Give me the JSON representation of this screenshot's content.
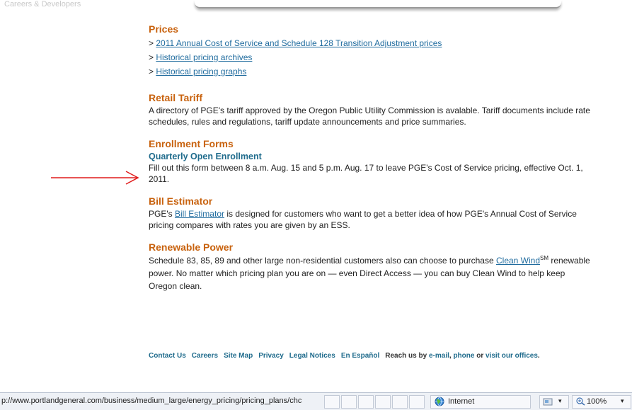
{
  "header": {
    "faded_text": "Careers & Developers"
  },
  "sections": {
    "prices": {
      "heading": "Prices",
      "links": [
        {
          "prefix": "> ",
          "label": "2011 Annual Cost of Service and Schedule 128 Transition Adjustment prices"
        },
        {
          "prefix": "> ",
          "label": "Historical pricing archives"
        },
        {
          "prefix": "> ",
          "label": "Historical pricing graphs"
        }
      ]
    },
    "retail_tariff": {
      "heading": "Retail Tariff",
      "body": "A directory of PGE's tariff approved by the Oregon Public Utility Commission is avalable. Tariff documents include rate schedules, rules and regulations, tariff update announcements and price summaries."
    },
    "enrollment_forms": {
      "heading": "Enrollment Forms",
      "subheading": "Quarterly Open Enrollment",
      "body": "Fill out this form between 8 a.m. Aug. 15 and 5 p.m. Aug. 17 to leave PGE's Cost of Service pricing, effective Oct. 1, 2011."
    },
    "bill_estimator": {
      "heading": "Bill Estimator",
      "body_before": "PGE's ",
      "link": "Bill Estimator",
      "body_after": " is designed for customers who want to get a better idea of how PGE's Annual Cost of Service pricing compares with rates you are given by an ESS."
    },
    "renewable_power": {
      "heading": "Renewable Power",
      "body_before": "Schedule 83, 85, 89 and other large non-residential customers also can choose to purchase ",
      "link": "Clean Wind",
      "sup": "SM",
      "body_after": " renewable power. No matter which pricing plan you are on — even Direct Access — you can buy Clean Wind to help keep Oregon clean."
    }
  },
  "footer": {
    "links": [
      "Contact Us",
      "Careers",
      "Site Map",
      "Privacy",
      "Legal Notices",
      "En Español"
    ],
    "reach_prefix": "Reach us by ",
    "email_link": "e-mail",
    "reach_sep1": ", ",
    "phone_link": "phone",
    "reach_sep2": " or ",
    "offices_link": "visit our offices",
    "reach_suffix": "."
  },
  "statusbar": {
    "url": "p://www.portlandgeneral.com/business/medium_large/energy_pricing/pricing_plans/chc",
    "zone": "Internet",
    "zoom": "100%",
    "zoom_caret": "▾",
    "protect_caret": "▾"
  },
  "colors": {
    "heading": "#c8620e",
    "subheading": "#1f6b8c",
    "link": "#1f6b9e",
    "annotation_arrow": "#e01b1b"
  },
  "icons": [
    "red-arrow-annotation-icon",
    "globe-icon",
    "protected-mode-icon",
    "zoom-icon"
  ]
}
